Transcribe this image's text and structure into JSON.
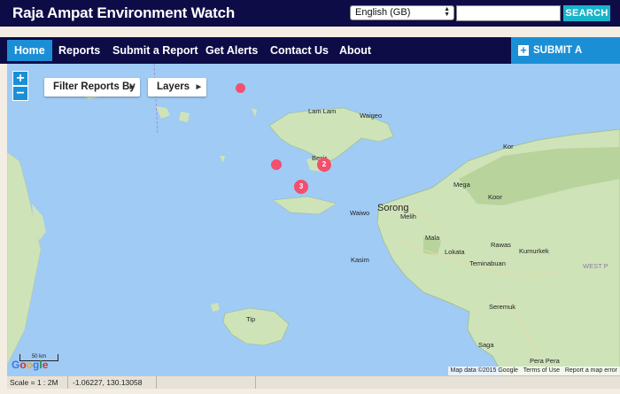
{
  "header": {
    "site_title": "Raja Ampat Environment Watch",
    "language": "English (GB)",
    "search_placeholder": "",
    "search_label": "SEARCH"
  },
  "nav": {
    "items": [
      "Home",
      "Reports",
      "Submit a Report",
      "Get Alerts",
      "Contact Us",
      "About"
    ],
    "active": "Home",
    "submit_button": "SUBMIT A REPORT",
    "submit_icon": "plus-square-icon"
  },
  "map": {
    "zoom_in": "+",
    "zoom_out": "−",
    "filter_button": "Filter Reports By",
    "layers_button": "Layers",
    "labels": [
      "Lam Lam",
      "Waigeo",
      "Besir",
      "Waiwo",
      "Sorong",
      "Melih",
      "Mega",
      "Kor",
      "Koor",
      "Mala",
      "Rawas",
      "Lokata",
      "Kumurkek",
      "Kasim",
      "Teminabuan",
      "Seremuk",
      "Tip",
      "Saga",
      "Pera Pera",
      "WEST P"
    ],
    "clusters": [
      {
        "count": "2",
        "status": "cluster"
      },
      {
        "count": "3",
        "status": "cluster"
      }
    ],
    "single_markers": 2,
    "scale_label": "50 km",
    "scale_sub": "20 mi",
    "google": "Google",
    "attribution": {
      "data": "Map data ©2015 Google",
      "terms": "Terms of Use",
      "report": "Report a map error"
    },
    "colors": {
      "water": "#9fcbf5",
      "land": "#cfe3b8",
      "marker": "#f2506e",
      "accent": "#1b8fd6",
      "navy": "#0e0c47"
    }
  },
  "status": {
    "scale": "Scale = 1 : 2M",
    "coords": "-1.06227, 130.13058"
  }
}
